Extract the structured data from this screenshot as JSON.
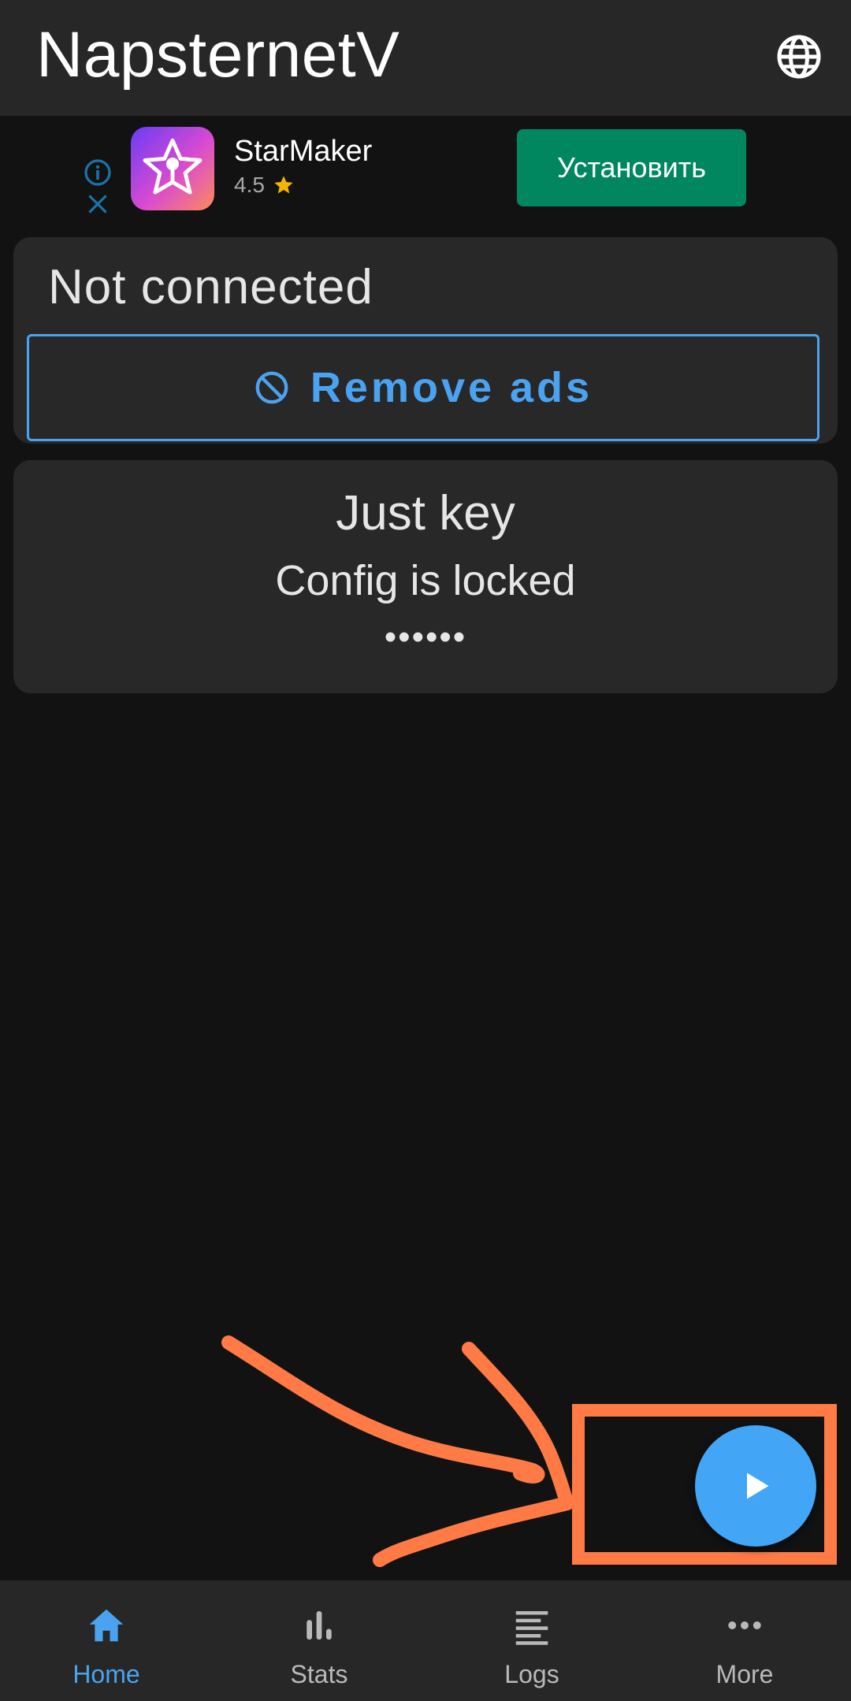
{
  "app_bar": {
    "title": "NapsternetV",
    "language_icon": "globe-icon"
  },
  "ad": {
    "info_icon": "info-icon",
    "close_icon": "close-icon",
    "app_icon": "starmaker-logo",
    "app_name": "StarMaker",
    "rating": "4.5",
    "rating_icon": "star-icon",
    "install_label": "Установить",
    "colors": {
      "install_bg": "#01875f",
      "star": "#f4b400",
      "info": "#1a73a8"
    }
  },
  "status": {
    "text": "Not connected",
    "remove_ads_icon": "block-icon",
    "remove_ads_label": "Remove ads"
  },
  "config": {
    "name": "Just key",
    "state": "Config is locked",
    "masked": "••••••"
  },
  "fab": {
    "icon": "play-icon"
  },
  "bottom_nav": {
    "items": [
      {
        "label": "Home",
        "icon": "home-icon",
        "active": true
      },
      {
        "label": "Stats",
        "icon": "bar-chart-icon",
        "active": false
      },
      {
        "label": "Logs",
        "icon": "list-icon",
        "active": false
      },
      {
        "label": "More",
        "icon": "more-horizontal-icon",
        "active": false
      }
    ]
  },
  "theme": {
    "accent": "#42a5f5",
    "accent_text": "#4aa3f0",
    "background": "#121212",
    "surface": "#282828",
    "bar": "#272727",
    "annotation": "#ff7a45"
  }
}
